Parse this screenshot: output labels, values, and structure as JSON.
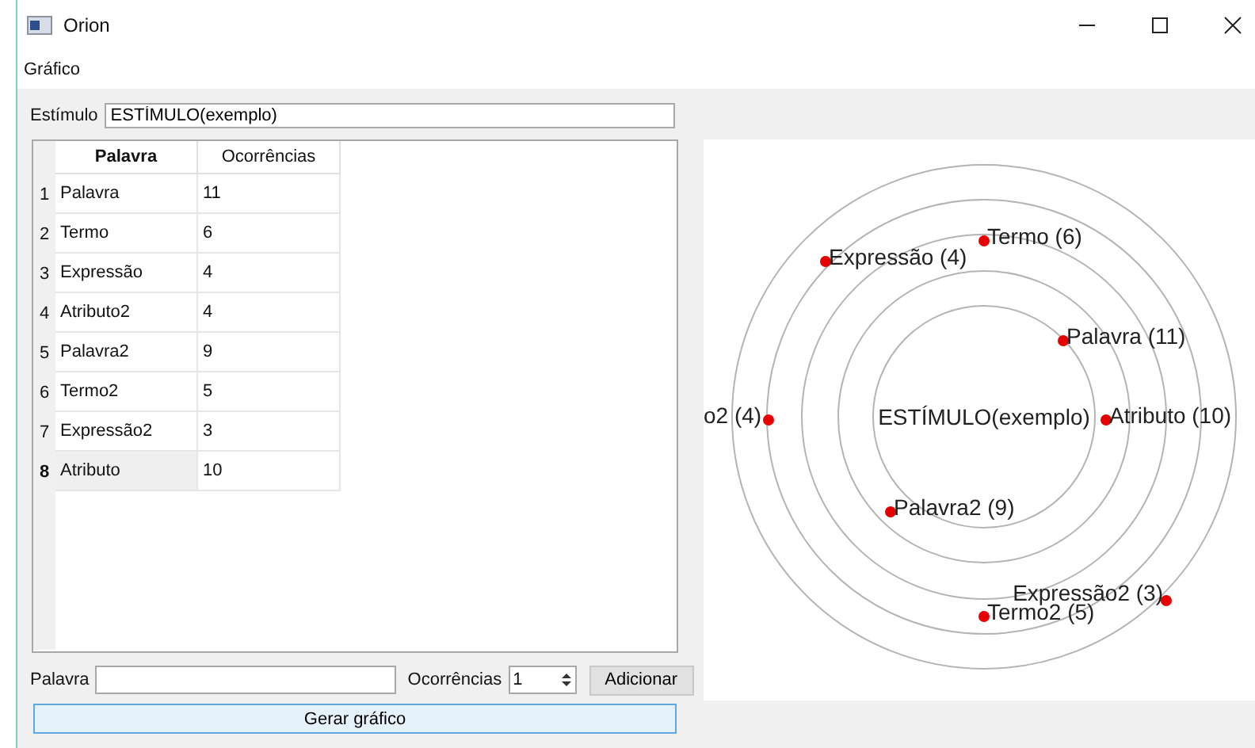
{
  "window": {
    "title": "Orion"
  },
  "menu": [
    "Gráfico"
  ],
  "stimulus": {
    "label": "Estímulo",
    "value": "ESTÍMULO(exemplo)"
  },
  "table": {
    "columns": [
      {
        "label": "Palavra",
        "selected": true
      },
      {
        "label": "Ocorrências",
        "selected": false
      }
    ],
    "rows": [
      {
        "number": "1",
        "word": "Palavra",
        "count": "11",
        "selected": false
      },
      {
        "number": "2",
        "word": "Termo",
        "count": "6",
        "selected": false
      },
      {
        "number": "3",
        "word": "Expressão",
        "count": "4",
        "selected": false
      },
      {
        "number": "4",
        "word": "Atributo2",
        "count": "4",
        "selected": false
      },
      {
        "number": "5",
        "word": "Palavra2",
        "count": "9",
        "selected": false
      },
      {
        "number": "6",
        "word": "Termo2",
        "count": "5",
        "selected": false
      },
      {
        "number": "7",
        "word": "Expressão2",
        "count": "3",
        "selected": false
      },
      {
        "number": "8",
        "word": "Atributo",
        "count": "10",
        "selected": true
      }
    ]
  },
  "form": {
    "word_label": "Palavra",
    "count_label": "Ocorrências",
    "count_value": "1",
    "add_button": "Adicionar"
  },
  "generate_button": "Gerar gráfico",
  "graph": {
    "center": "ESTÍMULO(exemplo)",
    "nodes": [
      {
        "label": "Termo (6)"
      },
      {
        "label": "Expressão (4)"
      },
      {
        "label": "Palavra  (11)"
      },
      {
        "label": "o2 (4)"
      },
      {
        "label": "Atributo (10)"
      },
      {
        "label": "Palavra2 (9)"
      },
      {
        "label": "Expressão2 (3)"
      },
      {
        "label": "Termo2 (5)"
      }
    ]
  }
}
